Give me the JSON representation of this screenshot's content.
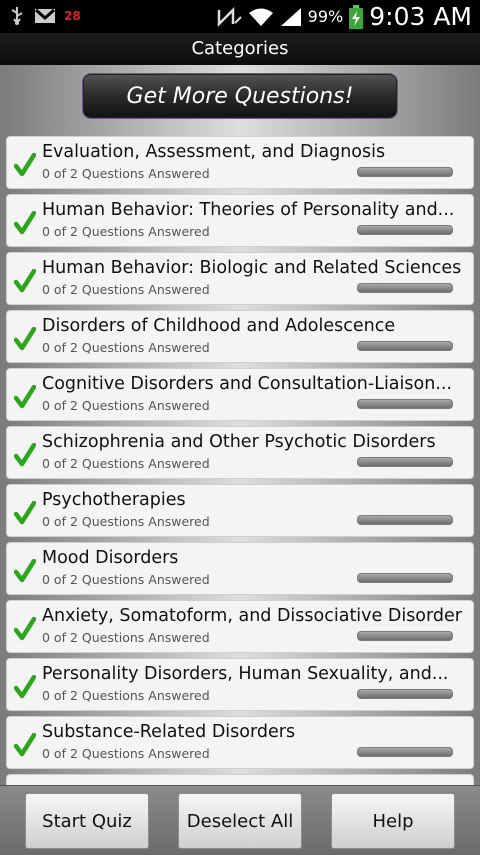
{
  "status_bar": {
    "notification_count": "28",
    "battery": "99%",
    "time": "9:03 AM"
  },
  "title": "Categories",
  "get_more_button": "Get More Questions!",
  "categories": [
    {
      "title": "Evaluation, Assessment, and Diagnosis",
      "subtitle": "0 of 2 Questions Answered",
      "progress": 0
    },
    {
      "title": "Human Behavior: Theories of Personality and...",
      "subtitle": "0 of 2 Questions Answered",
      "progress": 0
    },
    {
      "title": "Human Behavior: Biologic and Related Sciences",
      "subtitle": "0 of 2 Questions Answered",
      "progress": 0
    },
    {
      "title": "Disorders of Childhood and Adolescence",
      "subtitle": "0 of 2 Questions Answered",
      "progress": 0
    },
    {
      "title": "Cognitive Disorders and Consultation-Liaison...",
      "subtitle": "0 of 2 Questions Answered",
      "progress": 0
    },
    {
      "title": "Schizophrenia and Other Psychotic Disorders",
      "subtitle": "0 of 2 Questions Answered",
      "progress": 0
    },
    {
      "title": "Psychotherapies",
      "subtitle": "0 of 2 Questions Answered",
      "progress": 0
    },
    {
      "title": "Mood Disorders",
      "subtitle": "0 of 2 Questions Answered",
      "progress": 0
    },
    {
      "title": "Anxiety, Somatoform, and Dissociative Disorders",
      "subtitle": "0 of 2 Questions Answered",
      "progress": 0
    },
    {
      "title": "Personality Disorders, Human Sexuality, and...",
      "subtitle": "0 of 2 Questions Answered",
      "progress": 0
    },
    {
      "title": "Substance-Related Disorders",
      "subtitle": "0 of 2 Questions Answered",
      "progress": 0
    }
  ],
  "buttons": {
    "start_quiz": "Start Quiz",
    "deselect_all": "Deselect All",
    "help": "Help"
  },
  "colors": {
    "check": "#2da51c",
    "progress_track": "#8a8a8a"
  },
  "icons": [
    "usb-icon",
    "gmail-icon",
    "nfc-icon",
    "wifi-icon",
    "signal-icon",
    "battery-charging-icon",
    "checkmark-icon"
  ]
}
